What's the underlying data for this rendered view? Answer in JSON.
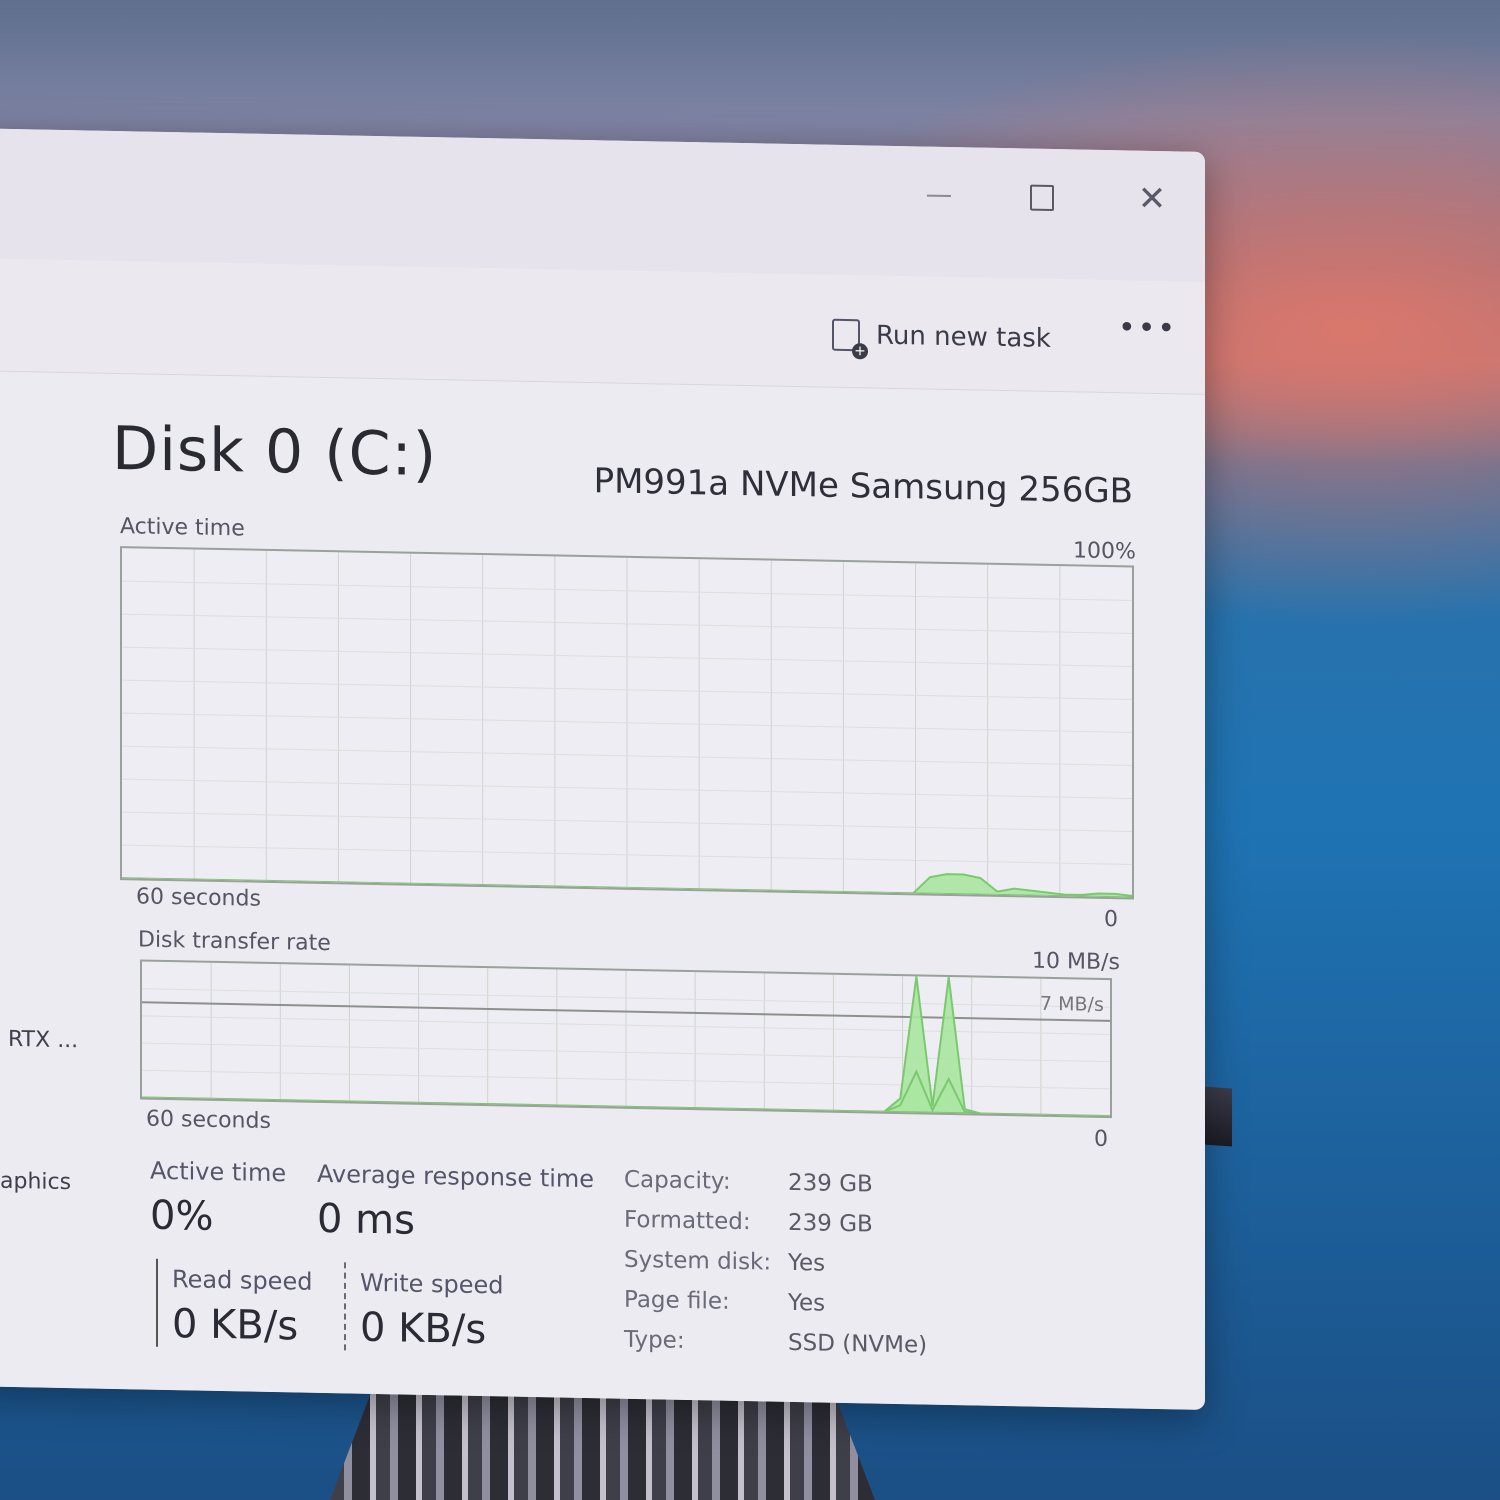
{
  "window": {
    "toolbar": {
      "run_new_task": "Run new task",
      "more": "•••"
    },
    "sidebar_fragments": {
      "rtx": "RTX ...",
      "graphics": "aphics"
    },
    "header": {
      "disk_title": "Disk 0 (C:)",
      "disk_model": "PM991a NVMe Samsung 256GB"
    },
    "active_time_chart": {
      "label": "Active time",
      "max_label": "100%",
      "time_label": "60 seconds",
      "min_label": "0"
    },
    "transfer_chart": {
      "label": "Disk transfer rate",
      "max_label": "10 MB/s",
      "line_label": "7 MB/s",
      "time_label": "60 seconds",
      "min_label": "0"
    },
    "stats": {
      "active_time": {
        "label": "Active time",
        "value": "0%"
      },
      "avg_response": {
        "label": "Average response time",
        "value": "0 ms"
      },
      "read_speed": {
        "label": "Read speed",
        "value": "0 KB/s"
      },
      "write_speed": {
        "label": "Write speed",
        "value": "0 KB/s"
      }
    },
    "properties": [
      {
        "label": "Capacity:",
        "value": "239 GB"
      },
      {
        "label": "Formatted:",
        "value": "239 GB"
      },
      {
        "label": "System disk:",
        "value": "Yes"
      },
      {
        "label": "Page file:",
        "value": "Yes"
      },
      {
        "label": "Type:",
        "value": "SSD (NVMe)"
      }
    ]
  },
  "chart_data": [
    {
      "type": "area",
      "title": "Active time",
      "xlabel": "60 seconds",
      "ylim": [
        0,
        100
      ],
      "x": [
        0,
        47,
        48,
        49,
        50,
        51,
        52,
        53,
        54,
        55,
        56,
        57,
        58,
        59,
        60
      ],
      "series": [
        {
          "values": [
            0,
            0,
            5,
            6,
            6,
            5,
            1,
            2,
            1.5,
            1,
            0.5,
            0.5,
            1,
            1,
            0.5
          ]
        }
      ],
      "colors": {
        "line": "#7bc96f",
        "fill": "#a8e6a0"
      }
    },
    {
      "type": "area",
      "title": "Disk transfer rate",
      "xlabel": "60 seconds",
      "ylim": [
        0,
        10
      ],
      "reference_line": 7,
      "x": [
        0,
        46,
        47,
        48,
        49,
        50,
        51,
        52,
        53,
        60
      ],
      "series": [
        {
          "values": [
            0,
            0,
            1,
            10,
            0.5,
            10,
            0.3,
            0,
            0,
            0
          ]
        },
        {
          "values": [
            0,
            0,
            0.5,
            3,
            0.2,
            2.5,
            0.1,
            0,
            0,
            0
          ]
        }
      ],
      "colors": {
        "line": "#7bc96f",
        "fill": "#a8e6a0"
      }
    }
  ]
}
